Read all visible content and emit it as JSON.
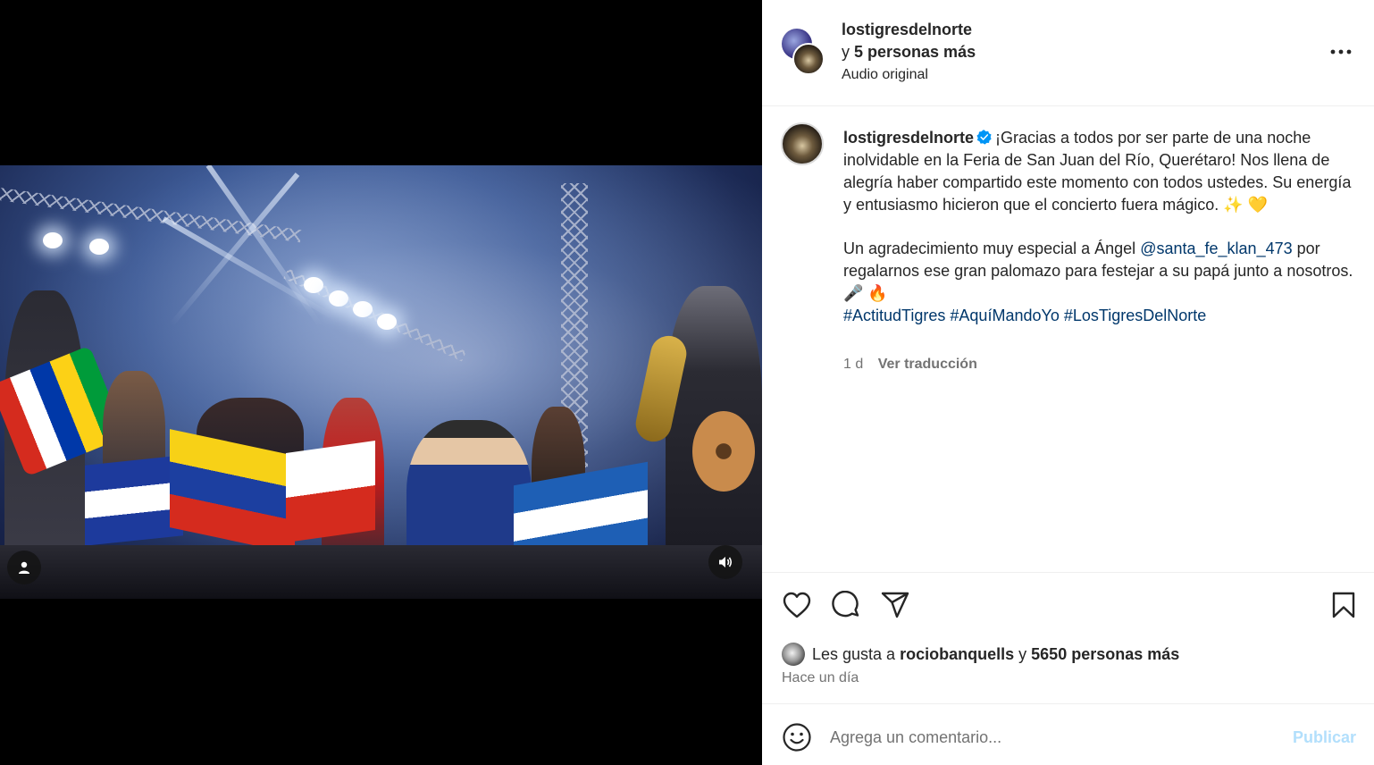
{
  "header": {
    "username": "lostigresdelnorte",
    "collab_prefix": "y",
    "collab_count": "5 personas más",
    "audio": "Audio original",
    "more_icon": "more-horizontal-icon"
  },
  "caption": {
    "username": "lostigresdelnorte",
    "paragraph1": "¡Gracias a todos por ser parte de una noche inolvidable en la Feria de San Juan del Río, Querétaro! Nos llena de alegría haber compartido este momento con todos ustedes. Su energía y entusiasmo hicieron que el concierto fuera mágico. ✨ 💛",
    "paragraph2_before": "Un agradecimiento muy especial a Ángel",
    "mention": "@santa_fe_klan_473",
    "paragraph2_after": "por regalarnos ese gran palomazo para festejar a su papá junto a nosotros. 🎤 🔥",
    "hashtags": [
      "#ActitudTigres",
      "#AquíMandoYo",
      "#LosTigresDelNorte"
    ],
    "age": "1 d",
    "translate": "Ver traducción"
  },
  "likes": {
    "prefix": "Les gusta a",
    "user": "rociobanquells",
    "conj": "y",
    "count": "5650 personas más",
    "time": "Hace un día"
  },
  "comment": {
    "placeholder": "Agrega un comentario...",
    "publish": "Publicar"
  },
  "colors": {
    "link": "#00376b",
    "secondary": "#737373",
    "publish_disabled": "#b2dffc",
    "verified": "#0095f6"
  }
}
